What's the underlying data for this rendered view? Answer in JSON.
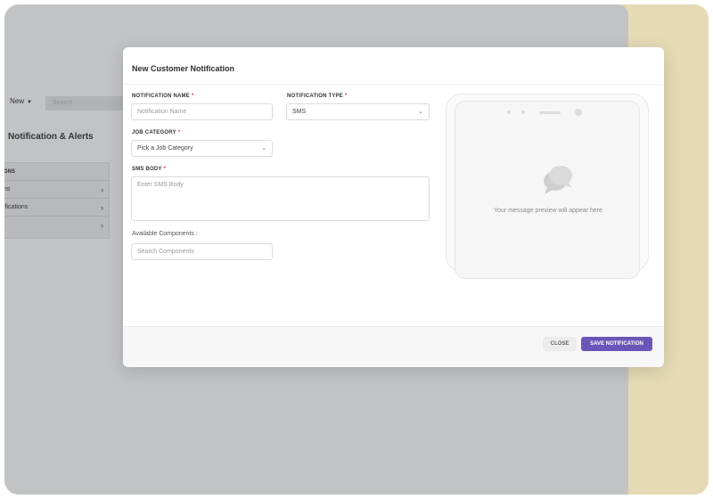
{
  "background_app": {
    "new_label": "New",
    "search_placeholder": "Search",
    "title": "Notification & Alerts",
    "panel": {
      "header": "ONS",
      "rows": [
        "ns",
        "ifications",
        ""
      ]
    }
  },
  "modal": {
    "title": "New Customer Notification",
    "fields": {
      "notification_name": {
        "label": "NOTIFICATION NAME",
        "placeholder": "Notification Name"
      },
      "notification_type": {
        "label": "NOTIFICATION TYPE",
        "value": "SMS"
      },
      "job_category": {
        "label": "JOB CATEGORY",
        "value": "Pick a Job Category"
      },
      "sms_body": {
        "label": "SMS BODY",
        "placeholder": "Enter SMS Body"
      },
      "components": {
        "label": "Available Components :",
        "placeholder": "Search Components"
      }
    },
    "required_marker": "*",
    "preview_text": "Your message preview will appear here",
    "buttons": {
      "close": "CLOSE",
      "save": "SAVE NOTIFICATION"
    }
  },
  "colors": {
    "accent": "#6a56b8",
    "backdrop": "#e6dab5",
    "overlay": "#c2c3c5",
    "required": "#e23b3b"
  },
  "icons": [
    "caret-down-icon",
    "chevron-right-icon",
    "chevron-down-icon",
    "chat-bubbles-icon"
  ]
}
